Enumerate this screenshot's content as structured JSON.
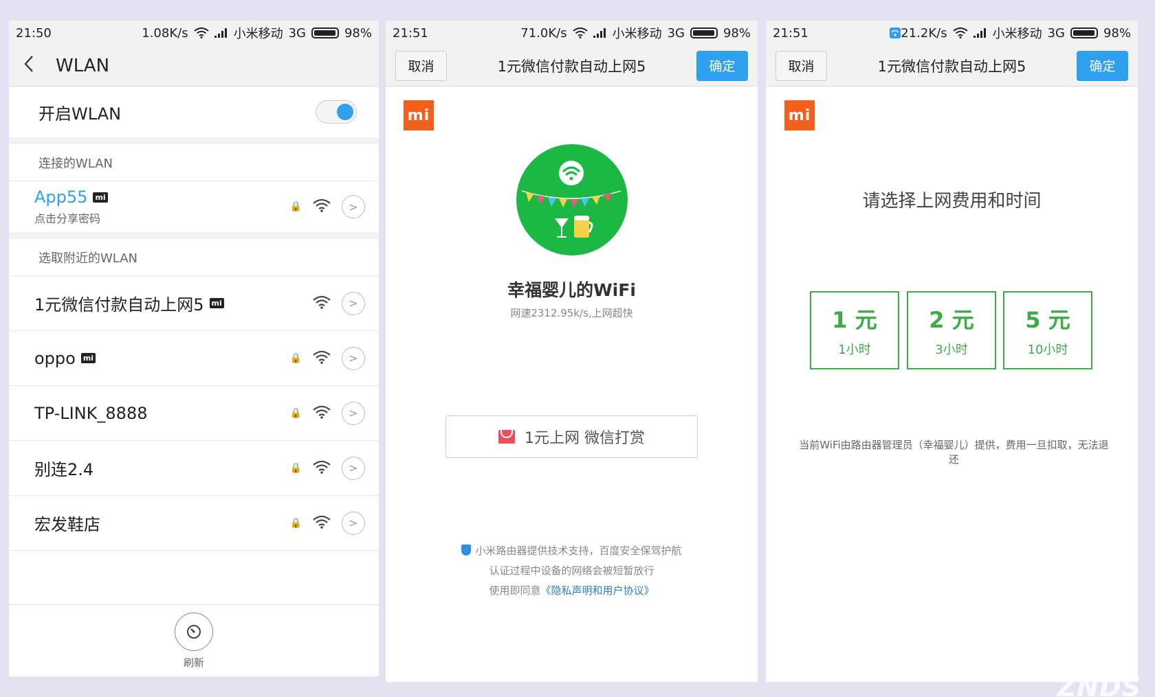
{
  "panel1": {
    "status": {
      "time": "21:50",
      "speed": "1.08K/s",
      "carrier": "小米移动",
      "network": "3G",
      "battery": "98%"
    },
    "header": {
      "back": "<",
      "title": "WLAN"
    },
    "toggle_label": "开启WLAN",
    "connected_section": "连接的WLAN",
    "connected": {
      "name": "App55",
      "sub": "点击分享密码"
    },
    "nearby_section": "选取附近的WLAN",
    "networks": [
      {
        "name": "1元微信付款自动上网5",
        "mi": true,
        "locked": false
      },
      {
        "name": "oppo",
        "mi": true,
        "locked": true
      },
      {
        "name": "TP-LINK_8888",
        "mi": false,
        "locked": true
      },
      {
        "name": "别连2.4",
        "mi": false,
        "locked": true
      },
      {
        "name": "宏发鞋店",
        "mi": false,
        "locked": true
      }
    ],
    "refresh_label": "刷新",
    "mi_badge": "mi",
    "lock": "🔒",
    "chevron": ">"
  },
  "panel2": {
    "status": {
      "time": "21:51",
      "speed": "71.0K/s",
      "carrier": "小米移动",
      "network": "3G",
      "battery": "98%"
    },
    "header": {
      "cancel": "取消",
      "title": "1元微信付款自动上网5",
      "ok": "确定"
    },
    "logo": "mi",
    "ssid_title": "幸福婴儿的WiFi",
    "speed_text": "网速2312.95k/s,上网超快",
    "pay_button": "1元上网 微信打赏",
    "footer_line1": "小米路由器提供技术支持，百度安全保驾护航",
    "footer_line2": "认证过程中设备的网络会被短暂放行",
    "footer_line3_prefix": "使用即同意",
    "footer_link": "《隐私声明和用户协议》"
  },
  "panel3": {
    "status": {
      "time": "21:51",
      "speed": "21.2K/s",
      "carrier": "小米移动",
      "network": "3G",
      "battery": "98%"
    },
    "header": {
      "cancel": "取消",
      "title": "1元微信付款自动上网5",
      "ok": "确定"
    },
    "logo": "mi",
    "prompt": "请选择上网费用和时间",
    "options": [
      {
        "price": "1 元",
        "duration": "1小时"
      },
      {
        "price": "2 元",
        "duration": "3小时"
      },
      {
        "price": "5 元",
        "duration": "10小时"
      }
    ],
    "disclaimer": "当前WiFi由路由器管理员（幸福婴儿）提供，费用一旦扣取，无法退还"
  },
  "colors": {
    "accent_blue": "#2ea0ee",
    "mi_orange": "#f35f1c",
    "wechat_green": "#1bb844",
    "option_green": "#3dab47"
  },
  "watermark": "ZNDS"
}
